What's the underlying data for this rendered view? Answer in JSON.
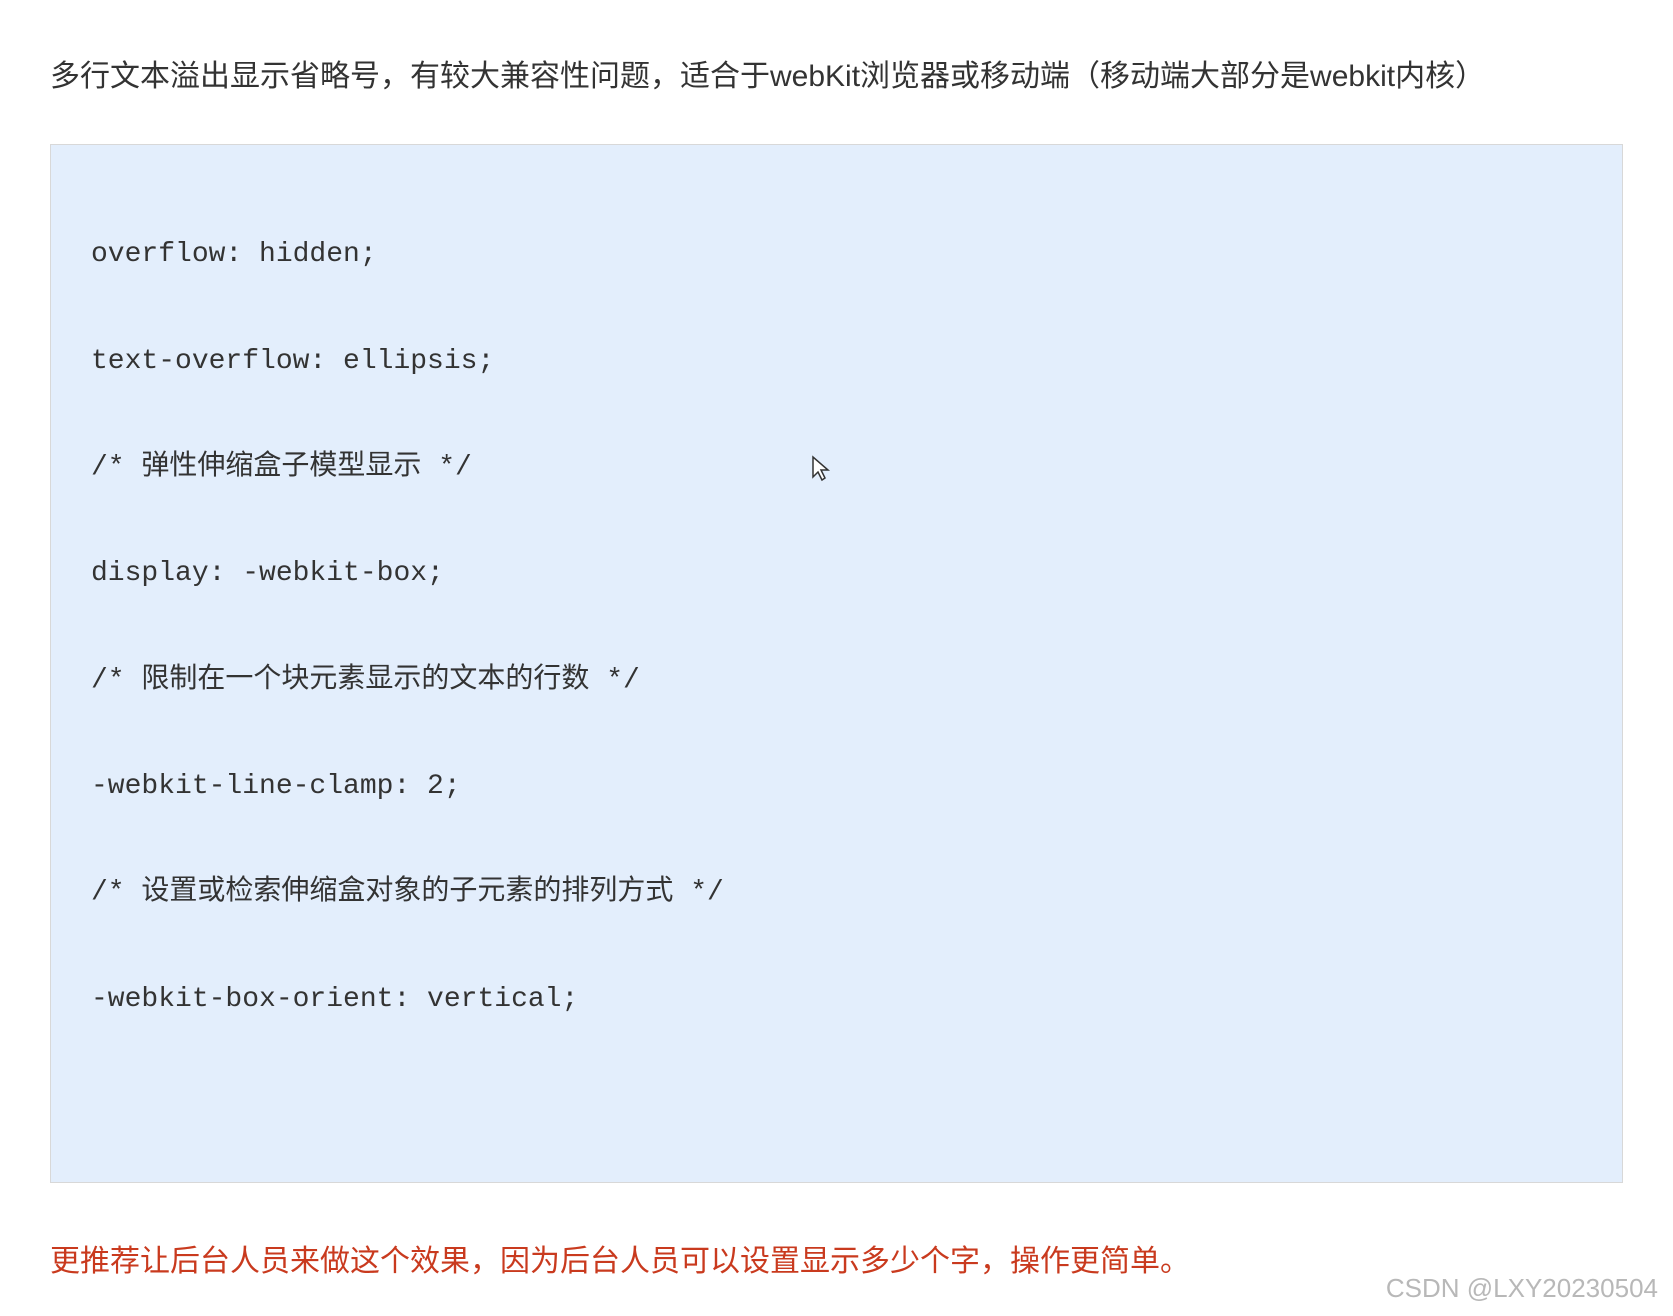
{
  "intro": "多行文本溢出显示省略号，有较大兼容性问题，适合于webKit浏览器或移动端（移动端大部分是webkit内核）",
  "code": {
    "line1": "overflow: hidden;",
    "line2": "text-overflow: ellipsis;",
    "line3": "/* 弹性伸缩盒子模型显示 */",
    "line4": "display: -webkit-box;",
    "line5": "/* 限制在一个块元素显示的文本的行数 */",
    "line6": "-webkit-line-clamp: 2;",
    "line7": "/* 设置或检索伸缩盒对象的子元素的排列方式 */",
    "line8": "-webkit-box-orient: vertical;"
  },
  "recommendation": "更推荐让后台人员来做这个效果，因为后台人员可以设置显示多少个字，操作更简单。",
  "watermark": "CSDN @LXY20230504"
}
